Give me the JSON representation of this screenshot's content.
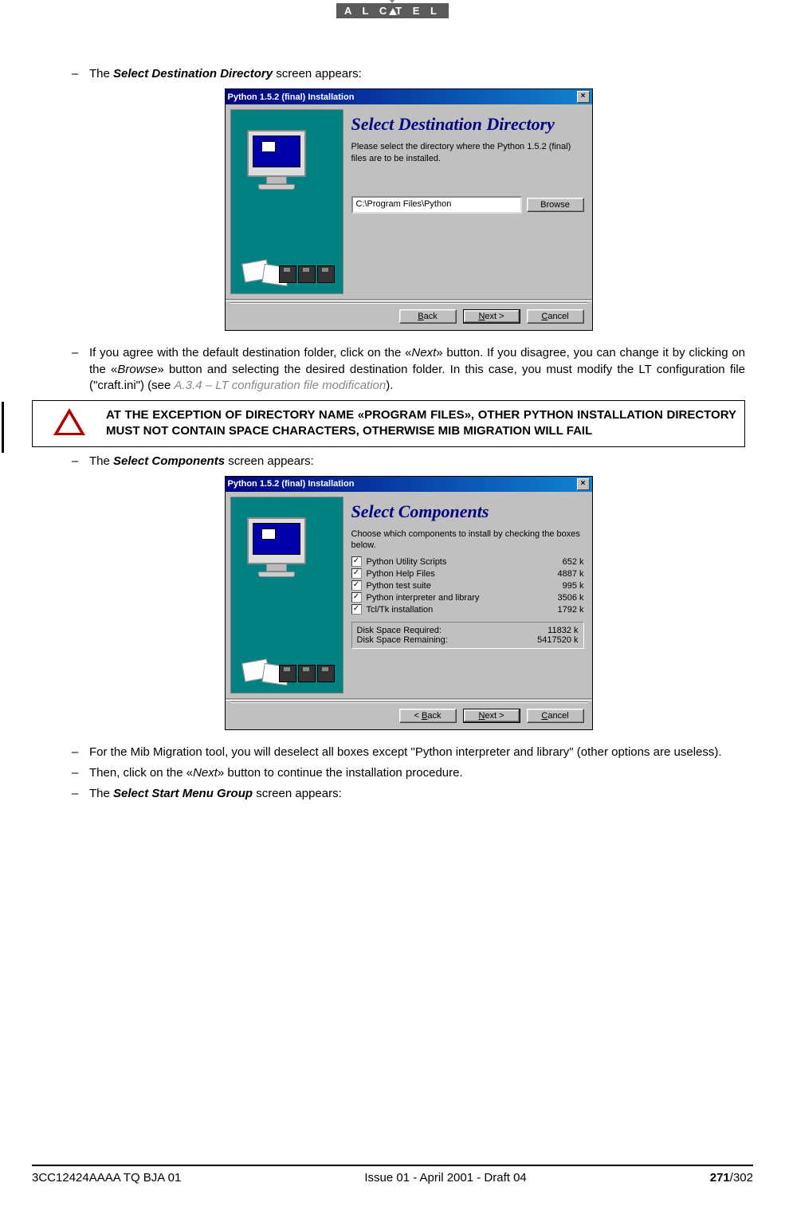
{
  "brand": "A L C A T E L",
  "intro1_pre": "The ",
  "intro1_bold": "Select Destination Directory",
  "intro1_post": " screen appears:",
  "dialog1": {
    "titlebar": "Python 1.5.2 (final) Installation",
    "heading": "Select Destination Directory",
    "instruction": "Please select the directory where the Python 1.5.2 (final) files are to be installed.",
    "path": "C:\\Program Files\\Python",
    "browse": "Browse",
    "back": "< Back",
    "next": "Next >",
    "cancel": "Cancel"
  },
  "para2_a": "If you agree with the default destination folder, click on the «",
  "para2_next": "Next",
  "para2_b": "» button. If you disagree, you can change it by clicking on the «",
  "para2_browse": "Browse",
  "para2_c": "» button and selecting the desired destination folder. In this case, you must modify the LT configuration file (\"craft.ini\") (see ",
  "para2_ref": "A.3.4 – LT configuration file modification",
  "para2_d": ").",
  "warning": "AT THE EXCEPTION OF DIRECTORY NAME «PROGRAM FILES», OTHER PYTHON INSTALLATION DIRECTORY MUST NOT CONTAIN SPACE CHARACTERS, OTHERWISE MIB MIGRATION WILL FAIL",
  "intro2_pre": "The ",
  "intro2_bold": "Select Components",
  "intro2_post": " screen appears:",
  "dialog2": {
    "titlebar": "Python 1.5.2 (final) Installation",
    "heading": "Select Components",
    "instruction": "Choose which components to install by checking the boxes below.",
    "items": [
      {
        "label": "Python Utility Scripts",
        "size": "652 k"
      },
      {
        "label": "Python Help Files",
        "size": "4887 k"
      },
      {
        "label": "Python test suite",
        "size": "995 k"
      },
      {
        "label": "Python interpreter and library",
        "size": "3506 k"
      },
      {
        "label": "Tcl/Tk installation",
        "size": "1792 k"
      }
    ],
    "req_label": "Disk Space Required:",
    "req_val": "11832 k",
    "rem_label": "Disk Space Remaining:",
    "rem_val": "5417520 k",
    "back": "< Back",
    "next": "Next >",
    "cancel": "Cancel"
  },
  "para3": "For the Mib Migration tool, you will deselect all boxes except \"Python interpreter and library\" (other options are useless).",
  "para4_a": "Then, click on the «",
  "para4_next": "Next",
  "para4_b": "» button to continue the installation procedure.",
  "intro3_pre": "The ",
  "intro3_bold": "Select Start Menu Group",
  "intro3_post": " screen appears:",
  "footer": {
    "left": "3CC12424AAAA TQ BJA 01",
    "center": "Issue 01 - April 2001 - Draft 04",
    "page_cur": "271",
    "page_total": "/302"
  }
}
